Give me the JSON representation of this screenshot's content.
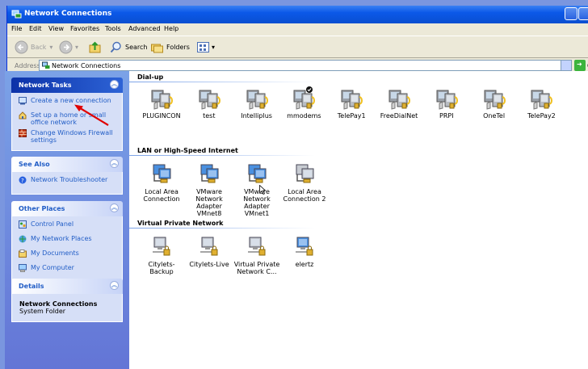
{
  "window": {
    "title": "Network Connections"
  },
  "menu": [
    "File",
    "Edit",
    "View",
    "Favorites",
    "Tools",
    "Advanced",
    "Help"
  ],
  "toolbar": {
    "back": "Back",
    "search": "Search",
    "folders": "Folders"
  },
  "address": {
    "label": "Address",
    "value": "Network Connections",
    "go": "G"
  },
  "sidebar": {
    "network_tasks": {
      "title": "Network Tasks",
      "items": [
        {
          "label": "Create a new connection",
          "icon": "new-connection-icon"
        },
        {
          "label": "Set up a home or small office network",
          "icon": "home-network-icon"
        },
        {
          "label": "Change Windows Firewall settings",
          "icon": "firewall-icon"
        }
      ]
    },
    "see_also": {
      "title": "See Also",
      "items": [
        {
          "label": "Network Troubleshooter",
          "icon": "help-icon"
        }
      ]
    },
    "other_places": {
      "title": "Other Places",
      "items": [
        {
          "label": "Control Panel",
          "icon": "control-panel-icon"
        },
        {
          "label": "My Network Places",
          "icon": "network-places-icon"
        },
        {
          "label": "My Documents",
          "icon": "documents-icon"
        },
        {
          "label": "My Computer",
          "icon": "computer-icon"
        }
      ]
    },
    "details": {
      "title": "Details",
      "name": "Network Connections",
      "type": "System Folder"
    }
  },
  "groups": {
    "dialup": {
      "title": "Dial-up",
      "items": [
        {
          "label": "PLUGINCON",
          "icon": "dialup-icon"
        },
        {
          "label": "test",
          "icon": "dialup-icon"
        },
        {
          "label": "Intelliplus",
          "icon": "dialup-icon"
        },
        {
          "label": "mmodems",
          "icon": "dialup-default-icon"
        },
        {
          "label": "TelePay1",
          "icon": "dialup-icon"
        },
        {
          "label": "FreeDialNet",
          "icon": "dialup-icon"
        },
        {
          "label": "PRPI",
          "icon": "dialup-icon"
        },
        {
          "label": "OneTel",
          "icon": "dialup-icon"
        },
        {
          "label": "TelePay2",
          "icon": "dialup-icon"
        }
      ]
    },
    "lan": {
      "title": "LAN or High-Speed Internet",
      "items": [
        {
          "label": "Local Area Connection",
          "icon": "lan-icon"
        },
        {
          "label": "VMware Network Adapter VMnet8",
          "icon": "lan-icon"
        },
        {
          "label": "VMware Network Adapter VMnet1",
          "icon": "lan-icon"
        },
        {
          "label": "Local Area Connection 2",
          "icon": "lan-disabled-icon"
        }
      ]
    },
    "vpn": {
      "title": "Virtual Private Network",
      "items": [
        {
          "label": "Citylets-Backup",
          "icon": "vpn-icon"
        },
        {
          "label": "Citylets-Live",
          "icon": "vpn-icon"
        },
        {
          "label": "Virtual Private Network C...",
          "icon": "vpn-icon"
        },
        {
          "label": "elertz",
          "icon": "vpn-active-icon"
        }
      ]
    }
  },
  "colors": {
    "title_bar": "#0b58e8",
    "sidebar": "#6d8de0",
    "link": "#215dc6",
    "annotation_arrow": "#e00000"
  }
}
